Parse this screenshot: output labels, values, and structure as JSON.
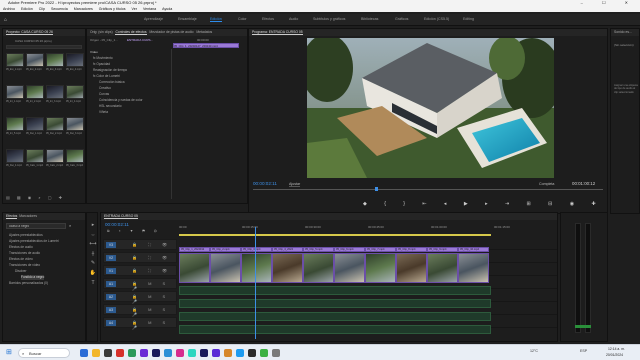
{
  "window": {
    "title": "Adobe Premiere Pro 2022 - H:\\proyectos premiere pro\\CASA CURSO 05 26.prproj *",
    "controls": "– ☐ ✕"
  },
  "menu": [
    "Archivo",
    "Edición",
    "Clip",
    "Secuencia",
    "Marcadores",
    "Gráficos y títulos",
    "Ver",
    "Ventana",
    "Ayuda"
  ],
  "workspaces": [
    {
      "label": "Aprendizaje",
      "active": false
    },
    {
      "label": "Ensamblaje",
      "active": false
    },
    {
      "label": "Edición",
      "active": true
    },
    {
      "label": "Color",
      "active": false
    },
    {
      "label": "Efectos",
      "active": false
    },
    {
      "label": "Audio",
      "active": false
    },
    {
      "label": "Subtítulos y gráficos",
      "active": false
    },
    {
      "label": "Bibliotecas",
      "active": false
    },
    {
      "label": "Gráficos",
      "active": false
    },
    {
      "label": "Edición (CS5.5)",
      "active": false
    },
    {
      "label": "Editing",
      "active": false
    }
  ],
  "project": {
    "title": "Proyecto: CASA CURSO 05 26",
    "file": "CASA CURSO 05 26.prproj",
    "items": [
      "05_Ext_1.mp4",
      "05_Ext_2.mp4",
      "05_Ext_3.mp4",
      "05_Ext_4.mp4",
      "05_Int_1.mp4",
      "05_Int_2.mp4",
      "05_Int_3.mp4",
      "05_Int_4.mp4",
      "05_Int_5.mp4",
      "05_Det_1.mp4",
      "05_Det_2.mp4",
      "05_Det_3.mp4",
      "05_Det_4.mp4",
      "05_Cam_1.mp4",
      "05_Cam_2.mp4",
      "05_Cam_3.mp4"
    ]
  },
  "source_tabs": {
    "tab1": "Orig: (sin clips)",
    "tab2": "Controles de efectos",
    "tab3": "Mezclador de pistas de audio",
    "tab4": "Metadatos",
    "origin": "Origen - 05_Clip_1...",
    "target": "ENTRADA CURS...",
    "clip": "05_Clip_1_20240127_203133.mp4"
  },
  "effect_controls": {
    "section": "Vídeo",
    "time": "00:00:00",
    "rows": [
      "Movimiento",
      "Opacidad",
      "Reasignación de tiempo",
      "Color de Lumetri",
      "Corrección básica",
      "Creativo",
      "Curvas",
      "Coincidencia y ruedas de color",
      "HSL secundario",
      "Viñeta"
    ]
  },
  "program": {
    "title": "Programa: ENTRADA CURSO 05",
    "timecode": "00:00:02:11",
    "fit": "Ajustar",
    "quality": "Completa",
    "duration": "00:01:00:12"
  },
  "right_panel": {
    "label": "Sonido es...",
    "sub": "(Sin selección)",
    "hint": "Asignar una etiqueta de tipo de audio al clip seleccionado"
  },
  "effects": {
    "tab1": "Efectos",
    "tab2": "Marcadores",
    "search": "ocaso a negro",
    "tree": [
      "Ajustes preestablecidos",
      "Ajustes preestablecidos de Lumetri",
      "Efectos de audio",
      "Transiciones de audio",
      "Efectos de vídeo",
      "Transiciones de vídeo",
      "Disolver",
      "Fundido a negro",
      "Barridos personalizados (0)"
    ]
  },
  "timeline": {
    "tab": "ENTRADA CURSO 05",
    "timecode": "00:00:02:11",
    "ruler": [
      "00:00",
      "00:00:15:00",
      "00:00:30:00",
      "00:00:45:00",
      "00:01:00:00",
      "00:01:15:00"
    ],
    "video_tracks": [
      "V3",
      "V2",
      "V1"
    ],
    "audio_tracks": [
      "A1",
      "A2",
      "A3",
      "A4"
    ],
    "clip_labels": [
      "05_Clip_1_2024012",
      "05_Clip_2.mp4",
      "05_Clip_3.mp4",
      "05_Clip_4_2024",
      "05_Clip_5.mp4",
      "05_Clip_6.mp4",
      "05_Clip_7.mp4",
      "05_Clip_8.mp4",
      "05_Clip_9.mp4",
      "05_Clip_10.mp4"
    ]
  },
  "taskbar": {
    "search": "Buscar",
    "temp": "12°C",
    "lang": "ESP",
    "time": "12:14 a. m.",
    "date": "20/01/2024"
  }
}
